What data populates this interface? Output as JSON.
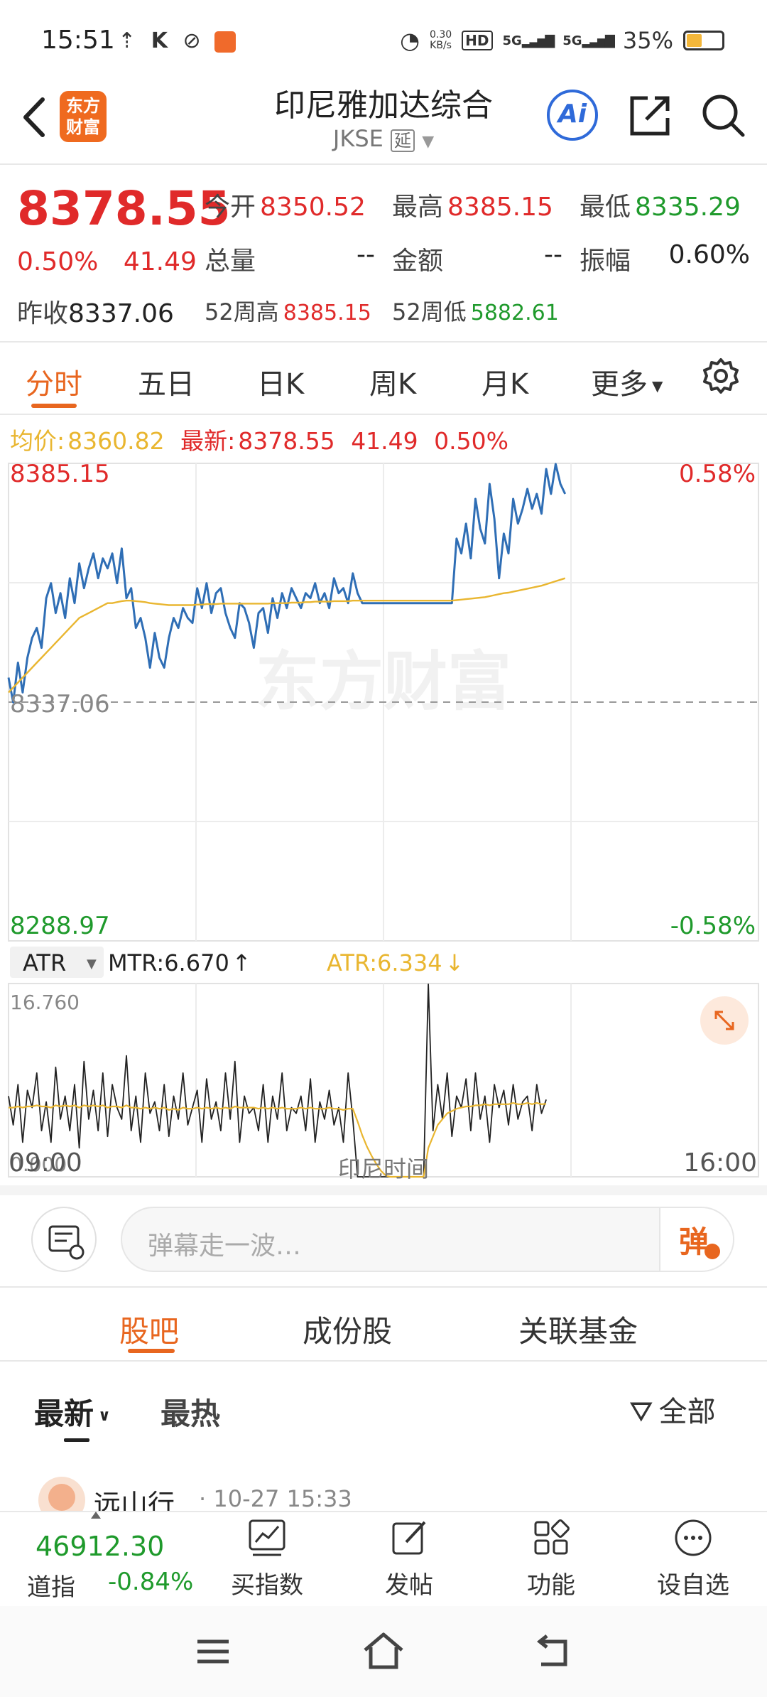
{
  "statusbar": {
    "time": "15:51",
    "net_speed": "0.30",
    "net_unit": "KB/s",
    "hd": "HD",
    "sim1": "5G",
    "sim2": "5G",
    "battery": "35%"
  },
  "header": {
    "logo_line1": "东方",
    "logo_line2": "财富",
    "title": "印尼雅加达综合",
    "code": "JKSE",
    "delay_tag": "延",
    "ai_label": "Ai"
  },
  "quote": {
    "price": "8378.55",
    "change_pct": "0.50%",
    "change": "41.49",
    "open_label": "今开",
    "open": "8350.52",
    "high_label": "最高",
    "high": "8385.15",
    "low_label": "最低",
    "low": "8335.29",
    "volume_label": "总量",
    "volume": "--",
    "amount_label": "金额",
    "amount": "--",
    "amplitude_label": "振幅",
    "amplitude": "0.60%",
    "prev_close_label": "昨收",
    "prev_close": "8337.06",
    "high52_label": "52周高",
    "high52": "8385.15",
    "low52_label": "52周低",
    "low52": "5882.61"
  },
  "tabs": [
    "分时",
    "五日",
    "日K",
    "周K",
    "月K",
    "更多"
  ],
  "chart_info": {
    "avg_label": "均价:",
    "avg_value": "8360.82",
    "latest_label": "最新:",
    "latest_value": "8378.55",
    "latest_change": "41.49",
    "latest_pct": "0.50%"
  },
  "chart_data": [
    {
      "type": "line",
      "y_top_label": "8385.15",
      "y_mid_label": "8337.06",
      "y_bottom_label": "8288.97",
      "pct_top_label": "0.58%",
      "pct_bottom_label": "-0.58%",
      "ylim": [
        8288.97,
        8385.15
      ],
      "prev_close": 8337.06,
      "x_start": "09:00",
      "x_end": "16:00",
      "x_center": "印尼时间",
      "watermark": "东方财富",
      "series": [
        {
          "name": "价格",
          "color": "#2f6eb5",
          "values": [
            8342,
            8337,
            8345,
            8339,
            8346,
            8350,
            8352,
            8348,
            8358,
            8361,
            8355,
            8359,
            8354,
            8362,
            8357,
            8365,
            8360,
            8364,
            8367,
            8362,
            8366,
            8364,
            8367,
            8361,
            8368,
            8358,
            8360,
            8352,
            8354,
            8350,
            8344,
            8351,
            8346,
            8344,
            8350,
            8354,
            8352,
            8356,
            8354,
            8353,
            8360,
            8356,
            8361,
            8355,
            8359,
            8360,
            8355,
            8352,
            8350,
            8357,
            8356,
            8353,
            8348,
            8355,
            8356,
            8351,
            8358,
            8354,
            8359,
            8356,
            8360,
            8358,
            8356,
            8359,
            8358,
            8361,
            8357,
            8359,
            8356,
            8362,
            8359,
            8360,
            8357,
            8363,
            8359,
            8357,
            8357,
            8357,
            8357,
            8357,
            8357,
            8357,
            8357,
            8357,
            8357,
            8357,
            8357,
            8357,
            8357,
            8357,
            8357,
            8357,
            8357,
            8357,
            8357,
            8370,
            8367,
            8373,
            8366,
            8378,
            8372,
            8369,
            8381,
            8374,
            8362,
            8371,
            8367,
            8378,
            8373,
            8376,
            8380,
            8376,
            8379,
            8375,
            8384,
            8379,
            8385,
            8381,
            8379
          ]
        },
        {
          "name": "均价",
          "color": "#e9b630",
          "values": [
            8339,
            8340,
            8341,
            8342,
            8343,
            8344,
            8345,
            8346,
            8347,
            8348,
            8349,
            8350,
            8351,
            8352,
            8353,
            8354,
            8354.5,
            8355,
            8355.5,
            8356,
            8356.5,
            8357,
            8357,
            8357.2,
            8357.4,
            8357.5,
            8357.5,
            8357.4,
            8357.3,
            8357.2,
            8357,
            8356.9,
            8356.8,
            8356.7,
            8356.6,
            8356.6,
            8356.6,
            8356.6,
            8356.6,
            8356.6,
            8356.7,
            8356.7,
            8356.8,
            8356.8,
            8356.8,
            8356.9,
            8356.9,
            8356.9,
            8356.9,
            8356.9,
            8356.9,
            8356.9,
            8356.9,
            8356.9,
            8356.9,
            8356.9,
            8357,
            8357,
            8357,
            8357,
            8357.1,
            8357.1,
            8357.1,
            8357.2,
            8357.2,
            8357.3,
            8357.3,
            8357.3,
            8357.3,
            8357.4,
            8357.4,
            8357.4,
            8357.4,
            8357.5,
            8357.5,
            8357.5,
            8357.5,
            8357.5,
            8357.5,
            8357.5,
            8357.5,
            8357.5,
            8357.5,
            8357.5,
            8357.5,
            8357.5,
            8357.5,
            8357.5,
            8357.5,
            8357.5,
            8357.5,
            8357.5,
            8357.5,
            8357.5,
            8357.5,
            8357.6,
            8357.7,
            8357.8,
            8357.9,
            8358,
            8358.1,
            8358.2,
            8358.4,
            8358.6,
            8358.8,
            8359,
            8359.1,
            8359.3,
            8359.5,
            8359.7,
            8359.9,
            8360.1,
            8360.3,
            8360.5,
            8360.8,
            8361.1,
            8361.4,
            8361.7,
            8362
          ]
        }
      ]
    },
    {
      "type": "line",
      "indicator": "ATR",
      "mtr_label": "MTR:6.670",
      "mtr_arrow": "↑",
      "atr_label": "ATR:6.334",
      "atr_arrow": "↓",
      "y_top_label": "16.760",
      "y_bottom_label": "0.000",
      "ylim": [
        0,
        16.76
      ],
      "series": [
        {
          "name": "MTR",
          "color": "#222222",
          "values": [
            7,
            4.5,
            8,
            3,
            7.5,
            6,
            9,
            4,
            6.5,
            3,
            9.5,
            5,
            7,
            4,
            8,
            2.5,
            10,
            5,
            7.5,
            4,
            9,
            3.5,
            8,
            6,
            5,
            10.5,
            4,
            7,
            3,
            9,
            5.5,
            6.5,
            4,
            8,
            3.5,
            7,
            5,
            9,
            4.5,
            6,
            7.5,
            3,
            8.5,
            5,
            6.5,
            4,
            9,
            5,
            10,
            3,
            7,
            5.5,
            6,
            4,
            8,
            3,
            7,
            5,
            9,
            4,
            6,
            5.5,
            7,
            4,
            8.5,
            3,
            6.5,
            5,
            7.5,
            4.5,
            6,
            3,
            9,
            5,
            0,
            0,
            0,
            0,
            0,
            0,
            0,
            0,
            0,
            0,
            0,
            0,
            0,
            0,
            0,
            16.7,
            4,
            8,
            5,
            9,
            3.5,
            7,
            6,
            8.5,
            4,
            9,
            5,
            7,
            3,
            8,
            6,
            7.5,
            4.5,
            8,
            5,
            6.5,
            7,
            4,
            8,
            5.5,
            6.7
          ]
        },
        {
          "name": "ATR",
          "color": "#e9b630",
          "values": [
            6,
            6,
            6.1,
            6,
            6.1,
            6.1,
            6.2,
            6.1,
            6.1,
            6,
            6.2,
            6.1,
            6.2,
            6.1,
            6.2,
            6,
            6.2,
            6.1,
            6.2,
            6.1,
            6.2,
            6,
            6.1,
            6.1,
            6,
            6.2,
            6,
            6,
            5.9,
            6,
            5.9,
            6,
            5.9,
            6,
            5.8,
            5.9,
            5.8,
            6,
            5.9,
            5.9,
            6,
            5.9,
            6,
            5.9,
            6,
            5.9,
            6,
            5.9,
            6.1,
            6,
            6,
            6,
            6,
            5.9,
            6,
            5.9,
            6,
            5.9,
            6,
            5.9,
            5.9,
            5.9,
            6,
            5.9,
            6,
            5.9,
            5.9,
            5.9,
            6,
            5.9,
            5.9,
            5.8,
            5.9,
            5.9,
            4.8,
            3.6,
            2.6,
            1.8,
            1.1,
            0.5,
            0.1,
            0,
            0,
            0,
            0,
            0,
            0,
            0,
            0,
            2.5,
            3.5,
            4.5,
            5,
            5.5,
            5.7,
            5.9,
            6,
            6.1,
            6.1,
            6.2,
            6.2,
            6.3,
            6.2,
            6.3,
            6.3,
            6.3,
            6.3,
            6.4,
            6.3,
            6.3,
            6.4,
            6.3,
            6.4,
            6.3,
            6.33
          ]
        }
      ]
    }
  ],
  "comment_bar": {
    "placeholder": "弹幕走一波…",
    "danmu_label": "弹"
  },
  "section_tabs": [
    "股吧",
    "成份股",
    "关联基金"
  ],
  "sort": {
    "latest": "最新",
    "hot": "最热",
    "filter": "全部"
  },
  "post": {
    "author": "远山行",
    "time": "10-27 15:33"
  },
  "footer": {
    "index_value": "46912.30",
    "index_name": "道指",
    "index_change": "-0.84%",
    "items": [
      "买指数",
      "发帖",
      "功能",
      "设自选"
    ]
  },
  "colors": {
    "accent": "#e8661f",
    "up": "#e02a2a",
    "down": "#1f9a2c",
    "price_line": "#2f6eb5",
    "avg_line": "#e9b630"
  }
}
